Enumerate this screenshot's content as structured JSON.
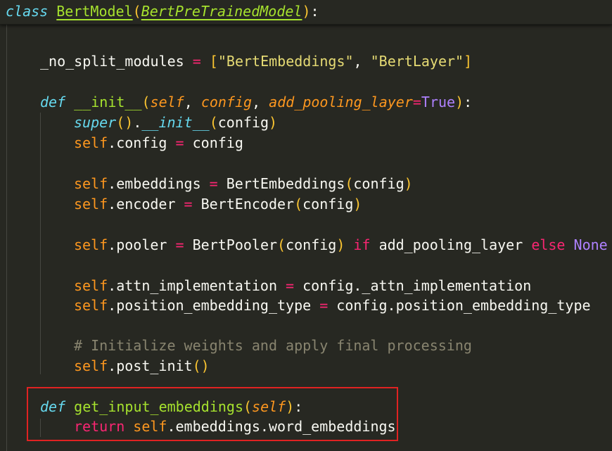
{
  "code": {
    "class_line": {
      "kw": "class",
      "name": "BertModel",
      "open": "(",
      "base": "BertPreTrainedModel",
      "close": ")",
      "colon": ":"
    },
    "no_split": {
      "name": "_no_split_modules",
      "eq": "=",
      "lb": "[",
      "s1": "\"BertEmbeddings\"",
      "comma": ",",
      "s2": "\"BertLayer\"",
      "rb": "]"
    },
    "init_def": {
      "kw": "def",
      "name": "__init__",
      "open": "(",
      "p_self": "self",
      "c1": ",",
      "p_config": "config",
      "c2": ",",
      "p_pool": "add_pooling_layer",
      "eq": "=",
      "default": "True",
      "close": ")",
      "colon": ":"
    },
    "super_line": {
      "fn": "super",
      "call": "()",
      "dot": ".",
      "method": "__init__",
      "open": "(",
      "arg": "config",
      "close": ")"
    },
    "config_line": {
      "self": "self",
      "rest": ".config",
      "eq": "=",
      "val": "config"
    },
    "emb_line": {
      "self": "self",
      "rest": ".embeddings",
      "eq": "=",
      "cls": "BertEmbeddings",
      "open": "(",
      "arg": "config",
      "close": ")"
    },
    "enc_line": {
      "self": "self",
      "rest": ".encoder",
      "eq": "=",
      "cls": "BertEncoder",
      "open": "(",
      "arg": "config",
      "close": ")"
    },
    "pool_line": {
      "self": "self",
      "rest": ".pooler",
      "eq": "=",
      "cls": "BertPooler",
      "open": "(",
      "arg": "config",
      "close": ")",
      "if": "if",
      "cond": "add_pooling_layer",
      "else": "else",
      "none": "None"
    },
    "attn_line": {
      "self": "self",
      "rest": ".attn_implementation",
      "eq": "=",
      "val": "config._attn_implementation"
    },
    "pos_line": {
      "self": "self",
      "rest": ".position_embedding_type",
      "eq": "=",
      "val": "config.position_embedding_type"
    },
    "comment_line": "# Initialize weights and apply final processing",
    "post_line": {
      "self": "self",
      "rest": ".post_init",
      "call": "()"
    },
    "get_def": {
      "kw": "def",
      "name": "get_input_embeddings",
      "open": "(",
      "p_self": "self",
      "close": ")",
      "colon": ":"
    },
    "return_line": {
      "kw": "return",
      "self": "self",
      "rest": ".embeddings.word_embeddings"
    }
  },
  "colors": {
    "background": "#272822",
    "keyword": "#f92672",
    "storage": "#66d9ef",
    "function": "#a6e22e",
    "parameter": "#fd971f",
    "string": "#e6db74",
    "constant": "#ae81ff",
    "comment": "#88846f",
    "bracket": "#fbc531",
    "highlight_border": "#e02222"
  }
}
